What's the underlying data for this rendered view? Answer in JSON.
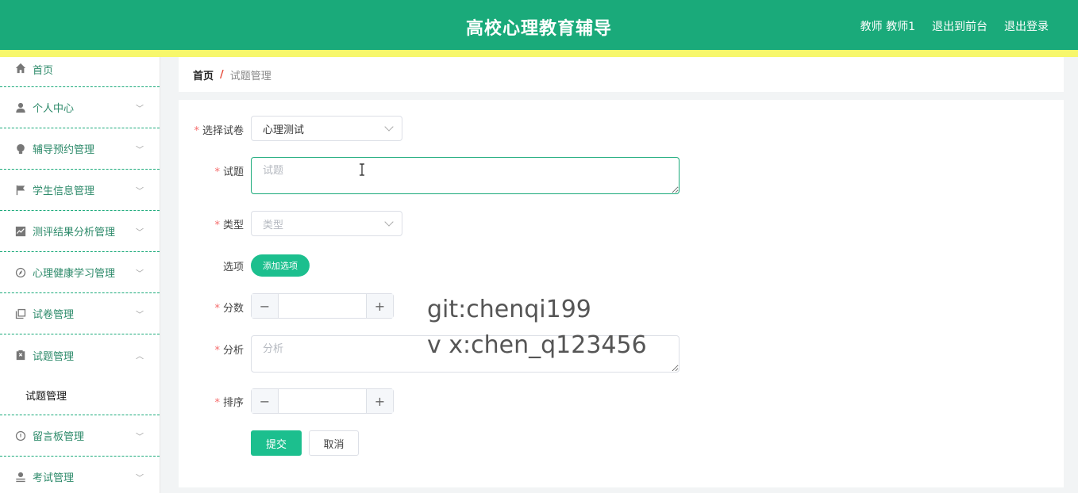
{
  "header": {
    "title": "高校心理教育辅导",
    "user": "教师 教师1",
    "links": [
      "退出到前台",
      "退出登录"
    ]
  },
  "sidebar": {
    "items": [
      {
        "label": "首页",
        "icon": "home-icon"
      },
      {
        "label": "个人中心",
        "icon": "user-icon"
      },
      {
        "label": "辅导预约管理",
        "icon": "bulb-icon"
      },
      {
        "label": "学生信息管理",
        "icon": "flag-icon"
      },
      {
        "label": "测评结果分析管理",
        "icon": "chart-icon"
      },
      {
        "label": "心理健康学习管理",
        "icon": "compass-icon"
      },
      {
        "label": "试卷管理",
        "icon": "copy-icon"
      },
      {
        "label": "试题管理",
        "icon": "clipboard-icon"
      },
      {
        "label": "留言板管理",
        "icon": "gauge-icon"
      },
      {
        "label": "考试管理",
        "icon": "user-plain-icon"
      }
    ],
    "submenu_label": "试题管理"
  },
  "breadcrumb": {
    "home": "首页",
    "separator": "/",
    "current": "试题管理"
  },
  "form": {
    "paper": {
      "label": "选择试卷",
      "value": "心理测试"
    },
    "question": {
      "label": "试题",
      "placeholder": "试题"
    },
    "type": {
      "label": "类型",
      "placeholder": "类型"
    },
    "options": {
      "label": "选项",
      "add_label": "添加选项"
    },
    "score": {
      "label": "分数",
      "value": ""
    },
    "analysis": {
      "label": "分析",
      "placeholder": "分析"
    },
    "order": {
      "label": "排序",
      "value": ""
    },
    "submit_label": "提交",
    "cancel_label": "取消",
    "minus_glyph": "−",
    "plus_glyph": "+",
    "required_mark": "*"
  },
  "watermark": {
    "line1": "git:chenqi199",
    "line2": "v x:chen_q123456"
  },
  "colors": {
    "header": "#1aaa7a",
    "stripe": "#f7f76c",
    "primary_button": "#1cbf8e",
    "required": "#f56c6c"
  }
}
